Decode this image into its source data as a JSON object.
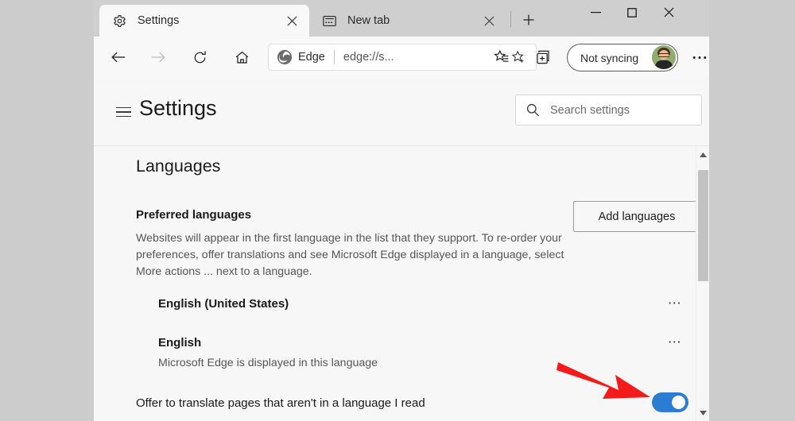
{
  "window": {
    "controls": {
      "minimize": "—",
      "maximize": "□",
      "close": "×"
    }
  },
  "tabs": [
    {
      "title": "Settings",
      "icon": "gear-icon",
      "active": true,
      "close": "×"
    },
    {
      "title": "New tab",
      "icon": "newspaper-icon",
      "active": false,
      "close": "×"
    }
  ],
  "new_tab_button": "+",
  "toolbar": {
    "back": "←",
    "forward": "→",
    "refresh": "↻",
    "home": "⌂",
    "omnibox": {
      "badge_label": "Edge",
      "url": "edge://s...",
      "favorite_icon": "star-add-icon"
    },
    "favorites_icon": "favorites-star-list-icon",
    "collections_icon": "collections-icon",
    "profile": {
      "label": "Not syncing",
      "avatar": "user-photo"
    },
    "more_icon": "⋯"
  },
  "settings_header": {
    "menu_icon": "hamburger-icon",
    "title": "Settings",
    "search": {
      "icon": "search-icon",
      "placeholder": "Search settings",
      "value": ""
    }
  },
  "content": {
    "section_title": "Languages",
    "subsection_title": "Preferred languages",
    "subsection_desc": "Websites will appear in the first language in the list that they support. To re-order your preferences, offer translations and see Microsoft Edge displayed in a language, select More actions ... next to a language.",
    "add_languages_button": "Add languages",
    "languages": [
      {
        "name": "English (United States)",
        "sub": "",
        "more": "⋯"
      },
      {
        "name": "English",
        "sub": "Microsoft Edge is displayed in this language",
        "more": "⋯"
      }
    ],
    "translate_setting": {
      "label": "Offer to translate pages that aren't in a language I read",
      "enabled": true
    }
  },
  "scrollbar": {
    "up_arrow": "▲",
    "down_arrow": "▼"
  },
  "annotation": {
    "arrow_color": "#f41b1b",
    "points_to": "translate-toggle"
  },
  "colors": {
    "toggle_on": "#2b7cd3",
    "tabstrip": "#cfcfcf",
    "page_bg": "#f7f7f7",
    "desktop": "#cccccc"
  }
}
